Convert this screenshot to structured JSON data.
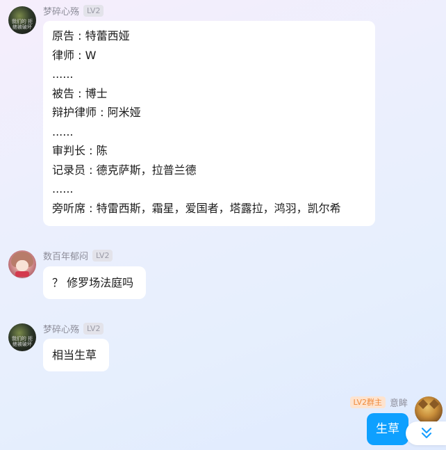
{
  "messages": [
    {
      "sender": "梦碎心殇",
      "level": "LV2",
      "avatar_text": "我们的 拒绝被破坏",
      "lines": [
        "原告 : 特蕾西娅",
        "律师 : W",
        "......",
        "被告 : 博士",
        "辩护律师 : 阿米娅",
        "......",
        "审判长 : 陈",
        "记录员 : 德克萨斯，拉普兰德",
        "......",
        "旁听席 : 特雷西斯，霜星，爱国者，塔露拉，鸿羽，凯尔希"
      ]
    },
    {
      "sender": "数百年郁闷",
      "level": "LV2",
      "lines": [
        "？ 修罗场法庭吗"
      ]
    },
    {
      "sender": "梦碎心殇",
      "level": "LV2",
      "avatar_text": "我们的 拒绝被破坏",
      "lines": [
        "相当生草"
      ]
    }
  ],
  "self_message": {
    "sender": "意眸",
    "badge": "LV2群主",
    "text": "生草"
  },
  "icons": {
    "scroll_down": "double-chevron-down-icon"
  },
  "colors": {
    "self_bubble": "#0ea0ff",
    "owner_badge_text": "#f08a3a",
    "scroll_icon": "#1aa0ff"
  }
}
